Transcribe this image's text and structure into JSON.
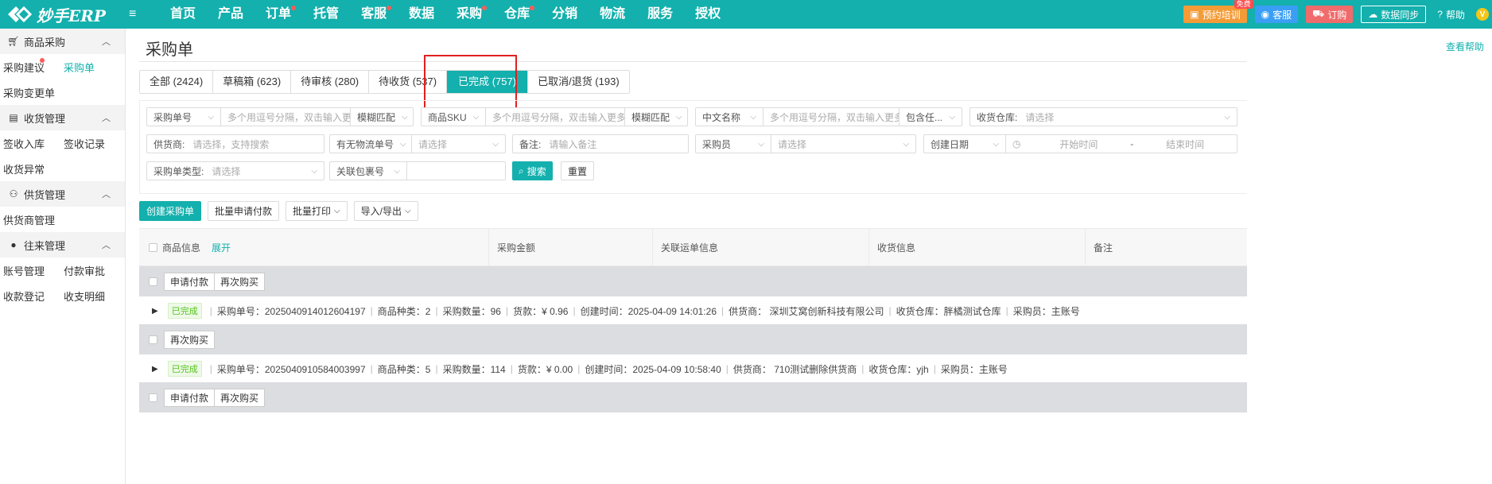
{
  "brand": {
    "name": "妙手ERP"
  },
  "nav": [
    {
      "label": "首页",
      "dot": false
    },
    {
      "label": "产品",
      "dot": false
    },
    {
      "label": "订单",
      "dot": true
    },
    {
      "label": "托管",
      "dot": false
    },
    {
      "label": "客服",
      "dot": true
    },
    {
      "label": "数据",
      "dot": false
    },
    {
      "label": "采购",
      "dot": true
    },
    {
      "label": "仓库",
      "dot": true
    },
    {
      "label": "分销",
      "dot": false
    },
    {
      "label": "物流",
      "dot": false
    },
    {
      "label": "服务",
      "dot": false
    },
    {
      "label": "授权",
      "dot": false
    }
  ],
  "topbar": {
    "training": "预约培训",
    "free_badge": "免费",
    "service": "客服",
    "order": "订购",
    "sync": "数据同步",
    "help": "帮助",
    "avatar": "V"
  },
  "sidebar": {
    "groups": [
      {
        "title": "商品采购",
        "icon": "cart-icon",
        "rows": [
          [
            {
              "label": "采购建议",
              "dot": true
            },
            {
              "label": "采购单",
              "active": true
            }
          ],
          [
            {
              "label": "采购变更单"
            }
          ]
        ]
      },
      {
        "title": "收货管理",
        "icon": "clipboard-icon",
        "rows": [
          [
            {
              "label": "签收入库"
            },
            {
              "label": "签收记录"
            }
          ],
          [
            {
              "label": "收货异常"
            }
          ]
        ]
      },
      {
        "title": "供货管理",
        "icon": "supplier-icon",
        "rows": [
          [
            {
              "label": "供货商管理"
            }
          ]
        ]
      },
      {
        "title": "往来管理",
        "icon": "user-icon",
        "rows": [
          [
            {
              "label": "账号管理"
            },
            {
              "label": "付款审批"
            }
          ],
          [
            {
              "label": "收款登记"
            },
            {
              "label": "收支明细"
            }
          ]
        ]
      }
    ]
  },
  "page": {
    "title": "采购单",
    "help": "查看帮助"
  },
  "tabs": [
    "全部 (2424)",
    "草稿箱 (623)",
    "待审核 (280)",
    "待收货 (537)",
    "已完成 (757)",
    "已取消/退货 (193)"
  ],
  "filters": {
    "order_no_select": "采购单号",
    "order_no_ph": "多个用逗号分隔，双击输入更多",
    "fuzzy1": "模糊匹配",
    "sku_select": "商品SKU",
    "sku_ph": "多个用逗号分隔，双击输入更多",
    "fuzzy2": "模糊匹配",
    "cn_name_select": "中文名称",
    "cn_name_ph": "多个用逗号分隔，双击输入更多",
    "contains": "包含任...",
    "warehouse_label": "收货仓库:",
    "warehouse_ph": "请选择",
    "supplier_label": "供货商:",
    "supplier_ph": "请选择，支持搜索",
    "logistics_select": "有无物流单号",
    "logistics_ph": "请选择",
    "remark_label": "备注:",
    "remark_ph": "请输入备注",
    "buyer_select": "采购员",
    "buyer_ph": "请选择",
    "date_select": "创建日期",
    "date_start": "开始时间",
    "date_sep": "-",
    "date_end": "结束时间",
    "type_label": "采购单类型:",
    "type_ph": "请选择",
    "package_select": "关联包裹号",
    "search": "搜索",
    "reset": "重置"
  },
  "actions": {
    "create": "创建采购单",
    "batch_pay": "批量申请付款",
    "batch_print": "批量打印",
    "import_export": "导入/导出"
  },
  "table": {
    "headers": [
      "商品信息",
      "采购金额",
      "关联运单信息",
      "收货信息",
      "备注"
    ],
    "expand": "展开",
    "groups": [
      {
        "buttons": [
          "申请付款",
          "再次购买"
        ],
        "status": "已完成",
        "fields": [
          "采购单号：2025040914012604197",
          "商品种类：2",
          "采购数量：96",
          "货款：¥ 0.96",
          "创建时间：2025-04-09 14:01:26",
          "供货商：  深圳艾窝创新科技有限公司",
          "收货仓库：胖橘测试仓库",
          "采购员：主账号"
        ]
      },
      {
        "buttons": [
          "再次购买"
        ],
        "status": "已完成",
        "fields": [
          "采购单号：2025040910584003997",
          "商品种类：5",
          "采购数量：114",
          "货款：¥ 0.00",
          "创建时间：2025-04-09 10:58:40",
          "供货商：  710测试删除供货商",
          "收货仓库：yjh",
          "采购员：主账号"
        ]
      },
      {
        "buttons": [
          "申请付款",
          "再次购买"
        ]
      }
    ]
  },
  "colors": {
    "brand": "#13b0ad",
    "highlight_box": "#e02020"
  }
}
